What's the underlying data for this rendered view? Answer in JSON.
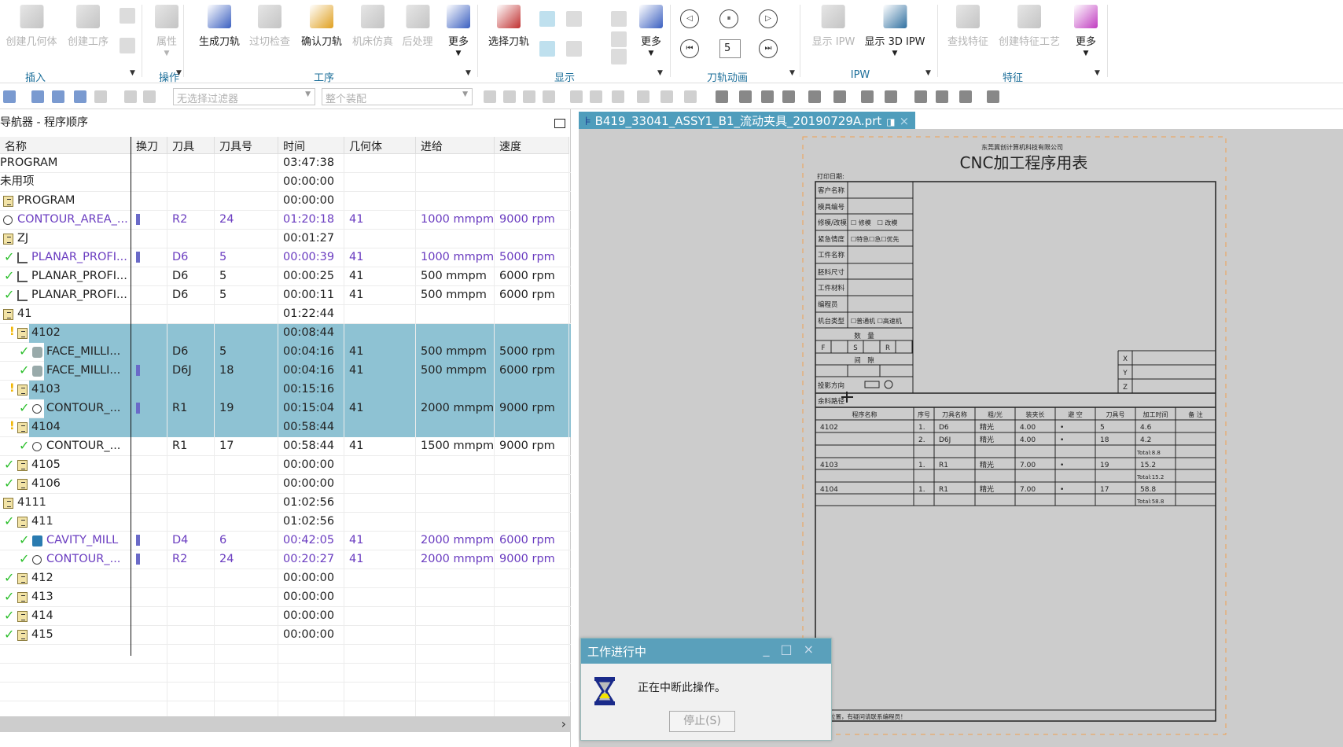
{
  "ribbon": {
    "buttons": [
      {
        "label": "创建几何体",
        "disabled": true
      },
      {
        "label": "创建工序",
        "disabled": true
      },
      {
        "label": "属性",
        "disabled": true
      },
      {
        "label": "生成刀轨",
        "disabled": false
      },
      {
        "label": "过切检查",
        "disabled": true
      },
      {
        "label": "确认刀轨",
        "disabled": false
      },
      {
        "label": "机床仿真",
        "disabled": true
      },
      {
        "label": "后处理",
        "disabled": true
      },
      {
        "label": "更多",
        "disabled": false
      },
      {
        "label": "选择刀轨",
        "disabled": false
      },
      {
        "label": "更多",
        "disabled": false
      },
      {
        "label": "显示 IPW",
        "disabled": true
      },
      {
        "label": "显示 3D IPW",
        "disabled": false
      },
      {
        "label": "查找特征",
        "disabled": true
      },
      {
        "label": "创建特征工艺",
        "disabled": true
      },
      {
        "label": "更多",
        "disabled": false
      }
    ],
    "groups": [
      "插入",
      "操作",
      "工序",
      "显示",
      "刀轨动画",
      "IPW",
      "特征"
    ],
    "animation_speed": "5"
  },
  "toolbar": {
    "filter_placeholder": "无选择过滤器",
    "assembly_placeholder": "整个装配"
  },
  "navigator": {
    "title": "导航器 - 程序顺序",
    "columns": [
      "名称",
      "换刀",
      "刀具",
      "刀具号",
      "时间",
      "几何体",
      "进给",
      "速度"
    ],
    "rows": [
      {
        "name": "PROGRAM",
        "depth": 0,
        "icon": "none",
        "check": false,
        "time": "03:47:38"
      },
      {
        "name": "未用项",
        "depth": 0,
        "icon": "none",
        "check": false,
        "time": "00:00:00"
      },
      {
        "name": "PROGRAM",
        "depth": 1,
        "icon": "folder",
        "check": false,
        "time": "00:00:00"
      },
      {
        "name": "CONTOUR_AREA_...",
        "depth": 1,
        "icon": "op",
        "check": false,
        "toolchange": true,
        "tool": "R2",
        "toolno": "24",
        "time": "01:20:18",
        "geom": "41",
        "feed": "1000 mmpm",
        "speed": "9000 rpm",
        "modified": true
      },
      {
        "name": "ZJ",
        "depth": 1,
        "icon": "folder",
        "check": false,
        "time": "00:01:27"
      },
      {
        "name": "PLANAR_PROFI...",
        "depth": 2,
        "icon": "planar",
        "check": true,
        "toolchange": true,
        "tool": "D6",
        "toolno": "5",
        "time": "00:00:39",
        "geom": "41",
        "feed": "1000 mmpm",
        "speed": "5000 rpm",
        "modified": true
      },
      {
        "name": "PLANAR_PROFI...",
        "depth": 2,
        "icon": "planar",
        "check": true,
        "tool": "D6",
        "toolno": "5",
        "time": "00:00:25",
        "geom": "41",
        "feed": "500 mmpm",
        "speed": "6000 rpm"
      },
      {
        "name": "PLANAR_PROFI...",
        "depth": 2,
        "icon": "planar",
        "check": true,
        "tool": "D6",
        "toolno": "5",
        "time": "00:00:11",
        "geom": "41",
        "feed": "500 mmpm",
        "speed": "6000 rpm"
      },
      {
        "name": "41",
        "depth": 1,
        "icon": "folder",
        "check": false,
        "time": "01:22:44"
      },
      {
        "name": "4102",
        "depth": 2,
        "icon": "folder",
        "warn": true,
        "time": "00:08:44",
        "selected": true
      },
      {
        "name": "FACE_MILLI...",
        "depth": 3,
        "icon": "face",
        "check": true,
        "tool": "D6",
        "toolno": "5",
        "time": "00:04:16",
        "geom": "41",
        "feed": "500 mmpm",
        "speed": "5000 rpm",
        "selected": true
      },
      {
        "name": "FACE_MILLI...",
        "depth": 3,
        "icon": "face",
        "check": true,
        "toolchange": true,
        "tool": "D6J",
        "toolno": "18",
        "time": "00:04:16",
        "geom": "41",
        "feed": "500 mmpm",
        "speed": "6000 rpm",
        "selected": true
      },
      {
        "name": "4103",
        "depth": 2,
        "icon": "folder",
        "warn": true,
        "time": "00:15:16",
        "selected": true
      },
      {
        "name": "CONTOUR_...",
        "depth": 3,
        "icon": "op",
        "check": true,
        "toolchange": true,
        "tool": "R1",
        "toolno": "19",
        "time": "00:15:04",
        "geom": "41",
        "feed": "2000 mmpm",
        "speed": "9000 rpm",
        "selected": true
      },
      {
        "name": "4104",
        "depth": 2,
        "icon": "folder",
        "warn": true,
        "time": "00:58:44",
        "selected": true
      },
      {
        "name": "CONTOUR_...",
        "depth": 3,
        "icon": "op",
        "check": true,
        "tool": "R1",
        "toolno": "17",
        "time": "00:58:44",
        "geom": "41",
        "feed": "1500 mmpm",
        "speed": "9000 rpm"
      },
      {
        "name": "4105",
        "depth": 2,
        "icon": "folder",
        "check": true,
        "time": "00:00:00"
      },
      {
        "name": "4106",
        "depth": 2,
        "icon": "folder",
        "check": true,
        "time": "00:00:00"
      },
      {
        "name": "4111",
        "depth": 1,
        "icon": "folder",
        "check": false,
        "time": "01:02:56"
      },
      {
        "name": "411",
        "depth": 2,
        "icon": "folder",
        "check": true,
        "time": "01:02:56"
      },
      {
        "name": "CAVITY_MILL",
        "depth": 3,
        "icon": "cavity",
        "check": true,
        "toolchange": true,
        "tool": "D4",
        "toolno": "6",
        "time": "00:42:05",
        "geom": "41",
        "feed": "2000 mmpm",
        "speed": "6000 rpm",
        "modified": true
      },
      {
        "name": "CONTOUR_...",
        "depth": 3,
        "icon": "op",
        "check": true,
        "toolchange": true,
        "tool": "R2",
        "toolno": "24",
        "time": "00:20:27",
        "geom": "41",
        "feed": "2000 mmpm",
        "speed": "9000 rpm",
        "modified": true
      },
      {
        "name": "412",
        "depth": 2,
        "icon": "folder",
        "check": true,
        "time": "00:00:00"
      },
      {
        "name": "413",
        "depth": 2,
        "icon": "folder",
        "check": true,
        "time": "00:00:00"
      },
      {
        "name": "414",
        "depth": 2,
        "icon": "folder",
        "check": true,
        "time": "00:00:00"
      },
      {
        "name": "415",
        "depth": 2,
        "icon": "folder",
        "check": true,
        "time": "00:00:00"
      }
    ]
  },
  "viewport": {
    "tab_label": "B419_33041_ASSY1_B1_流动夹具_20190729A.prt",
    "sheet": {
      "company": "东莞冀创计算机科技有限公司",
      "title": "CNC加工程序用表",
      "print_date_label": "打印日期:",
      "form_labels": [
        "客户名称",
        "模具编号",
        "修模/改模",
        "紧急情度",
        "工件名称",
        "胚料尺寸",
        "工件材料",
        "编程员",
        "机台类型"
      ],
      "form_values": [
        "",
        "",
        "☐ 修模　☐ 改模",
        "☐特急☐急☐优先",
        "",
        "",
        "",
        "",
        "☐普通机 ☐高速机"
      ],
      "qty_label": "数　量",
      "qty_cells": [
        "F",
        "S",
        "R"
      ],
      "gap_label": "间　隙",
      "projection_label": "投影方向",
      "axes": [
        "X",
        "Y",
        "Z"
      ],
      "stock_label": "余料路径",
      "table_headers": [
        "程序名称",
        "序号",
        "刀具名称",
        "粗/光",
        "装夹长",
        "避 空",
        "刀具号",
        "加工时间",
        "备 注"
      ],
      "table_rows": [
        [
          "4102",
          "1.",
          "D6",
          "精光",
          "4.00",
          "•",
          "5",
          "4.6",
          ""
        ],
        [
          "",
          "2.",
          "D6J",
          "精光",
          "4.00",
          "•",
          "18",
          "4.2",
          ""
        ],
        [
          "",
          "",
          "",
          "",
          "",
          "",
          "",
          "Total:8.8",
          ""
        ],
        [
          "4103",
          "1.",
          "R1",
          "精光",
          "7.00",
          "•",
          "19",
          "15.2",
          ""
        ],
        [
          "",
          "",
          "",
          "",
          "",
          "",
          "",
          "Total:15.2",
          ""
        ],
        [
          "4104",
          "1.",
          "R1",
          "精光",
          "7.00",
          "•",
          "17",
          "58.8",
          ""
        ],
        [
          "",
          "",
          "",
          "",
          "",
          "",
          "",
          "Total:58.8",
          ""
        ]
      ],
      "footer_note": "刚数位置，有疑问请联系编程员！"
    }
  },
  "dialog": {
    "title": "工作进行中",
    "message": "正在中断此操作。",
    "stop_label": "停止(S)"
  },
  "colors": {
    "accent": "#5aa0bb",
    "selection": "#8ec2d3",
    "modified_text": "#6a3cc0",
    "check": "#2ec02e"
  }
}
